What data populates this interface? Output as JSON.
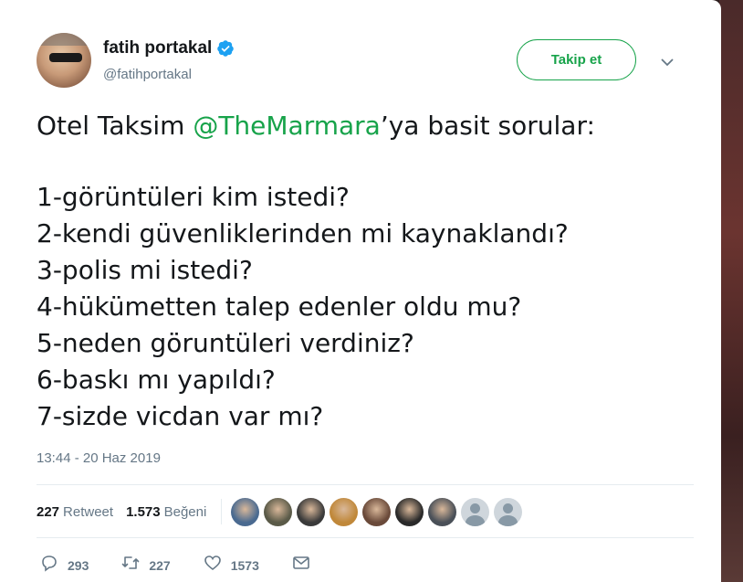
{
  "author": {
    "display_name": "fatih portakal",
    "handle": "@fatihportakal",
    "verified": true
  },
  "follow_button": {
    "label": "Takip et"
  },
  "tweet": {
    "line1_prefix": "Otel Taksim ",
    "line1_mention": "@TheMarmara",
    "line1_suffix": "’ya basit sorular:",
    "questions": [
      "1-görüntüleri kim istedi?",
      "2-kendi güvenliklerinden mi kaynaklandı?",
      "3-polis mi istedi?",
      "4-hükümetten talep edenler oldu mu?",
      "5-neden göruntüleri verdiniz?",
      "6-baskı mı yapıldı?",
      "7-sizde vicdan var mı?"
    ]
  },
  "timestamp": "13:44 - 20 Haz 2019",
  "stats": {
    "retweets_num": "227",
    "retweets_label": "Retweet",
    "likes_num": "1.573",
    "likes_label": "Beğeni"
  },
  "likers": [
    {
      "color": "#4a6a90"
    },
    {
      "color": "#5a5a48"
    },
    {
      "color": "#3a3a3a"
    },
    {
      "color": "#c0883a"
    },
    {
      "color": "#6a4a3a"
    },
    {
      "color": "#2a2a2a"
    },
    {
      "color": "#4a5058"
    },
    {
      "default": true
    },
    {
      "default": true
    }
  ],
  "actions": {
    "reply_count": "293",
    "retweet_count": "227",
    "like_count": "1573"
  },
  "colors": {
    "accent": "#17a34a",
    "verified": "#1da1f2",
    "muted": "#657786"
  }
}
